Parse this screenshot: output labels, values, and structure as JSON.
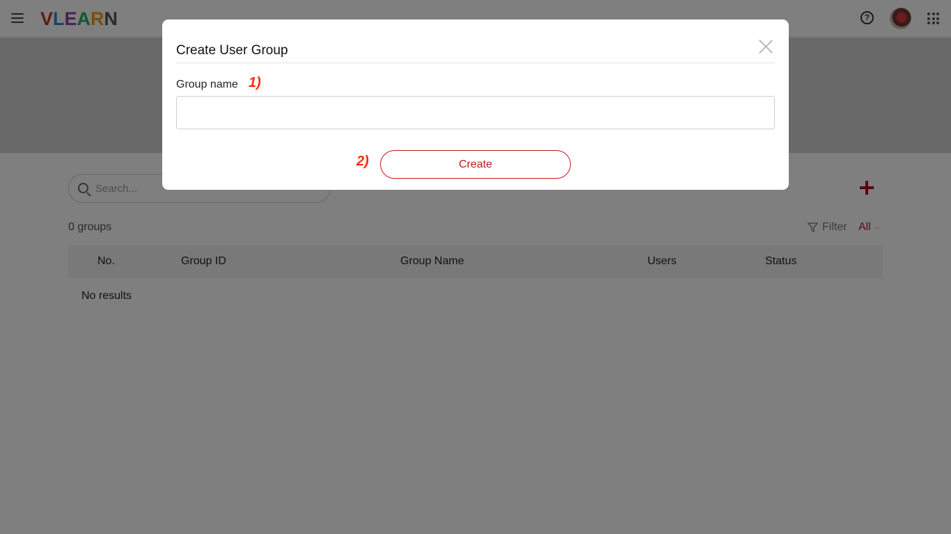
{
  "app": {
    "logo_text": {
      "v": "V",
      "l": "L",
      "e": "E",
      "a": "A",
      "r": "R",
      "n": "N"
    }
  },
  "header": {
    "help_icon": "question-circle-icon",
    "help_glyph": "?",
    "apps_icon": "grid-dots-icon"
  },
  "list": {
    "search_placeholder": "Search...",
    "count_text": "0 groups",
    "filter_label": "Filter",
    "filter_value": "All",
    "filter_chevron": "⌵",
    "columns": [
      "No.",
      "Group ID",
      "Group Name",
      "Users",
      "Status"
    ],
    "empty_text": "No results"
  },
  "modal": {
    "title": "Create User Group",
    "group_name_label": "Group name",
    "group_name_value": "",
    "step_1": "1)",
    "step_2": "2)",
    "create_label": "Create"
  },
  "colors": {
    "accent": "#c4161c",
    "step_marker": "#ff2a00",
    "overlay": "rgba(0,0,0,0.5)"
  }
}
